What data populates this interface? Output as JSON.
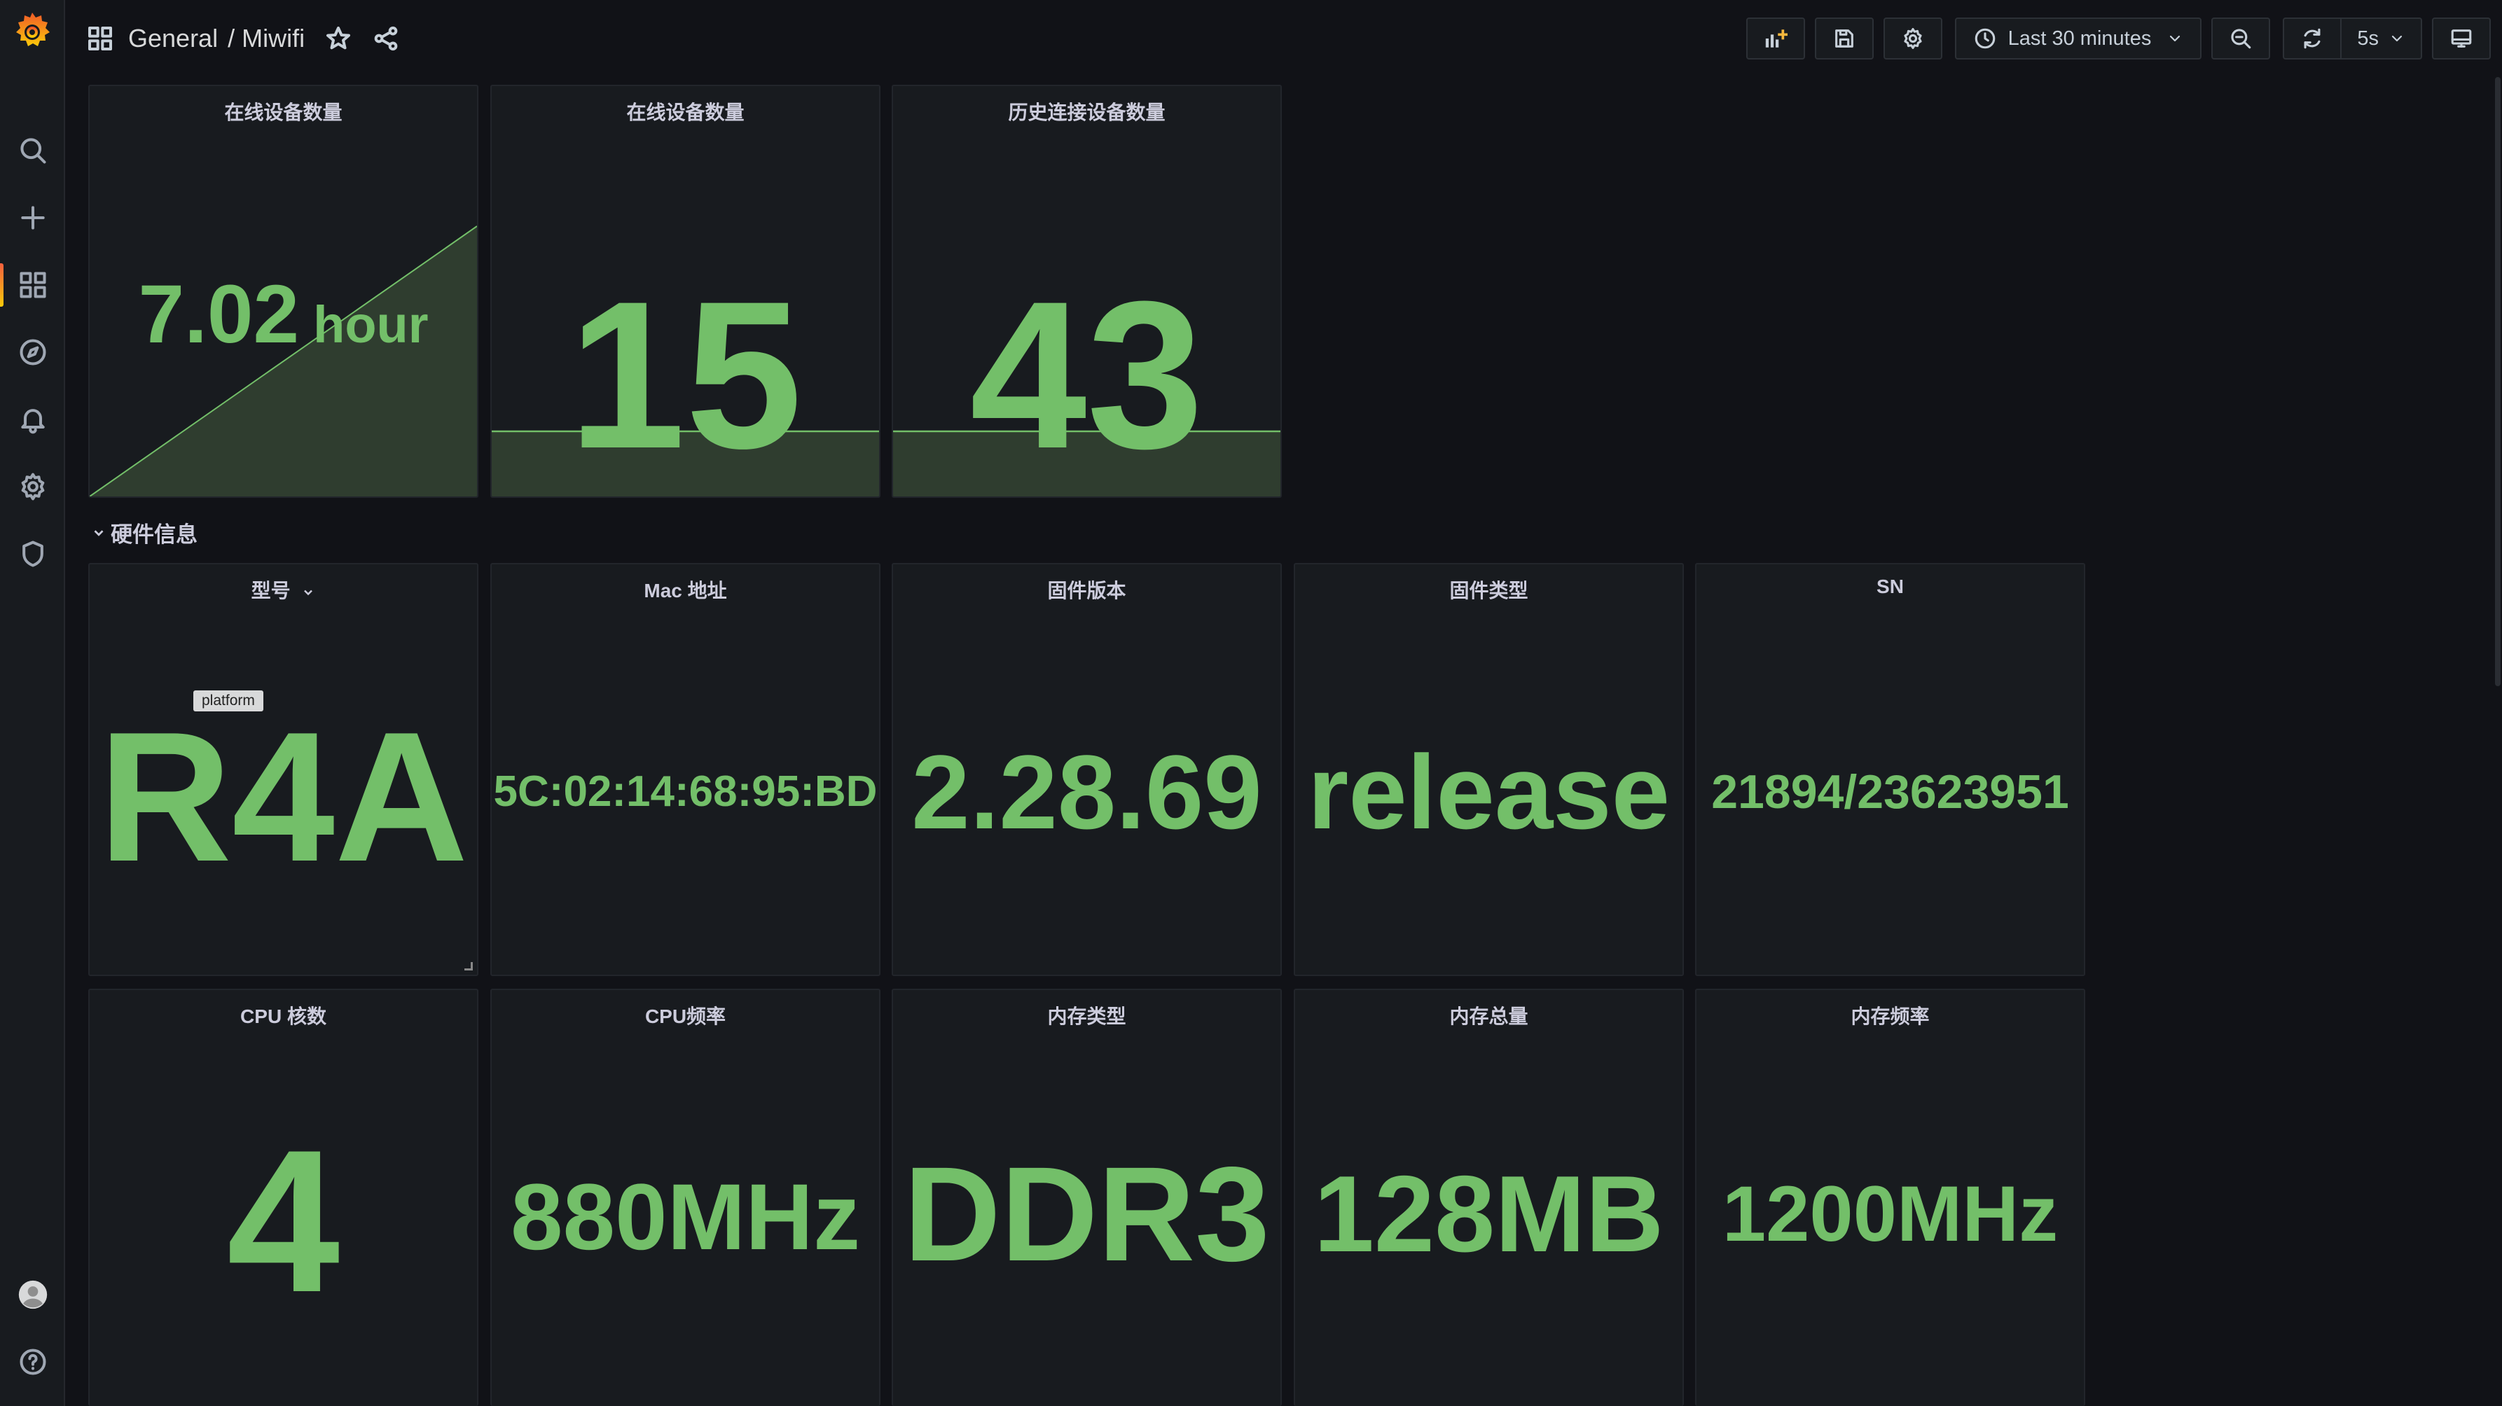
{
  "breadcrumb": {
    "folder": "General",
    "separator": "/",
    "dashboard": "Miwifi"
  },
  "toolbar": {
    "time_range": "Last 30 minutes",
    "refresh_interval": "5s"
  },
  "colors": {
    "value_green": "#73bf69",
    "sparkline_fill": "#2f3d2f",
    "background": "#111217",
    "panel": "#181b1f"
  },
  "sidebar": {
    "items": [
      "search-icon",
      "plus-icon",
      "dashboards-icon",
      "explore-icon",
      "alerting-icon",
      "configuration-icon",
      "shield-icon",
      "avatar",
      "help-icon"
    ]
  },
  "top_panels": [
    {
      "title": "在线设备数量",
      "value": "7.02",
      "unit": "hour"
    },
    {
      "title": "在线设备数量",
      "value": "15"
    },
    {
      "title": "历史连接设备数量",
      "value": "43"
    }
  ],
  "row": {
    "title": "硬件信息"
  },
  "hardware_panels": [
    {
      "title": "型号",
      "value": "R4A",
      "tag": "platform"
    },
    {
      "title": "Mac 地址",
      "value": "5C:02:14:68:95:BD"
    },
    {
      "title": "固件版本",
      "value": "2.28.69"
    },
    {
      "title": "固件类型",
      "value": "release"
    },
    {
      "title": "SN",
      "value": "21894/23623951"
    }
  ],
  "hw_panels_2": [
    {
      "title": "CPU 核数",
      "value": "4"
    },
    {
      "title": "CPU频率",
      "value": "880MHz"
    },
    {
      "title": "内存类型",
      "value": "DDR3"
    },
    {
      "title": "内存总量",
      "value": "128MB"
    },
    {
      "title": "内存频率",
      "value": "1200MHz"
    }
  ]
}
